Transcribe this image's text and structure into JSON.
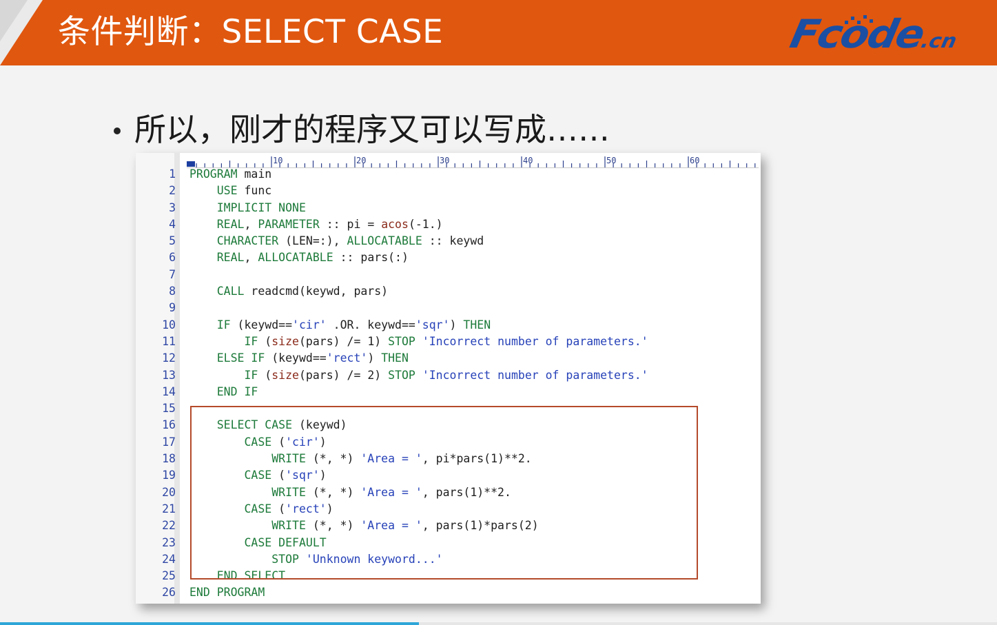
{
  "header": {
    "title": "条件判断：SELECT CASE",
    "logo_text": "Fcode",
    "logo_suffix": ".cn",
    "background_color": "#e0570f"
  },
  "bullet": {
    "text": "所以，刚才的程序又可以写成……"
  },
  "editor": {
    "ruler_labels": [
      "10",
      "20",
      "30",
      "40",
      "50",
      "60"
    ],
    "lines": [
      {
        "n": "1",
        "tokens": [
          [
            "kw",
            "PROGRAM"
          ],
          [
            "plain",
            " main"
          ]
        ]
      },
      {
        "n": "2",
        "tokens": [
          [
            "plain",
            "    "
          ],
          [
            "kw",
            "USE"
          ],
          [
            "plain",
            " func"
          ]
        ]
      },
      {
        "n": "3",
        "tokens": [
          [
            "plain",
            "    "
          ],
          [
            "kw",
            "IMPLICIT NONE"
          ]
        ]
      },
      {
        "n": "4",
        "tokens": [
          [
            "plain",
            "    "
          ],
          [
            "kw",
            "REAL"
          ],
          [
            "plain",
            ", "
          ],
          [
            "kw",
            "PARAMETER"
          ],
          [
            "plain",
            " :: pi = "
          ],
          [
            "fn",
            "acos"
          ],
          [
            "plain",
            "(-1.)"
          ]
        ]
      },
      {
        "n": "5",
        "tokens": [
          [
            "plain",
            "    "
          ],
          [
            "kw",
            "CHARACTER"
          ],
          [
            "plain",
            " (LEN=:), "
          ],
          [
            "kw",
            "ALLOCATABLE"
          ],
          [
            "plain",
            " :: keywd"
          ]
        ]
      },
      {
        "n": "6",
        "tokens": [
          [
            "plain",
            "    "
          ],
          [
            "kw",
            "REAL"
          ],
          [
            "plain",
            ", "
          ],
          [
            "kw",
            "ALLOCATABLE"
          ],
          [
            "plain",
            " :: pars(:)"
          ]
        ]
      },
      {
        "n": "7",
        "tokens": []
      },
      {
        "n": "8",
        "tokens": [
          [
            "plain",
            "    "
          ],
          [
            "kw",
            "CALL"
          ],
          [
            "plain",
            " readcmd(keywd, pars)"
          ]
        ]
      },
      {
        "n": "9",
        "tokens": []
      },
      {
        "n": "10",
        "tokens": [
          [
            "plain",
            "    "
          ],
          [
            "kw",
            "IF"
          ],
          [
            "plain",
            " (keywd=="
          ],
          [
            "str",
            "'cir'"
          ],
          [
            "plain",
            " .OR. keywd=="
          ],
          [
            "str",
            "'sqr'"
          ],
          [
            "plain",
            ") "
          ],
          [
            "kw",
            "THEN"
          ]
        ]
      },
      {
        "n": "11",
        "tokens": [
          [
            "plain",
            "        "
          ],
          [
            "kw",
            "IF"
          ],
          [
            "plain",
            " ("
          ],
          [
            "fn",
            "size"
          ],
          [
            "plain",
            "(pars) /= 1) "
          ],
          [
            "kw",
            "STOP"
          ],
          [
            "plain",
            " "
          ],
          [
            "str",
            "'Incorrect number of parameters.'"
          ]
        ]
      },
      {
        "n": "12",
        "tokens": [
          [
            "plain",
            "    "
          ],
          [
            "kw",
            "ELSE IF"
          ],
          [
            "plain",
            " (keywd=="
          ],
          [
            "str",
            "'rect'"
          ],
          [
            "plain",
            ") "
          ],
          [
            "kw",
            "THEN"
          ]
        ]
      },
      {
        "n": "13",
        "tokens": [
          [
            "plain",
            "        "
          ],
          [
            "kw",
            "IF"
          ],
          [
            "plain",
            " ("
          ],
          [
            "fn",
            "size"
          ],
          [
            "plain",
            "(pars) /= 2) "
          ],
          [
            "kw",
            "STOP"
          ],
          [
            "plain",
            " "
          ],
          [
            "str",
            "'Incorrect number of parameters.'"
          ]
        ]
      },
      {
        "n": "14",
        "tokens": [
          [
            "plain",
            "    "
          ],
          [
            "kw",
            "END IF"
          ]
        ]
      },
      {
        "n": "15",
        "tokens": []
      },
      {
        "n": "16",
        "tokens": [
          [
            "plain",
            "    "
          ],
          [
            "kw",
            "SELECT CASE"
          ],
          [
            "plain",
            " (keywd)"
          ]
        ]
      },
      {
        "n": "17",
        "tokens": [
          [
            "plain",
            "        "
          ],
          [
            "kw",
            "CASE"
          ],
          [
            "plain",
            " ("
          ],
          [
            "str",
            "'cir'"
          ],
          [
            "plain",
            ")"
          ]
        ]
      },
      {
        "n": "18",
        "tokens": [
          [
            "plain",
            "            "
          ],
          [
            "kw",
            "WRITE"
          ],
          [
            "plain",
            " (*, *) "
          ],
          [
            "str",
            "'Area = '"
          ],
          [
            "plain",
            ", pi*pars(1)**2."
          ]
        ]
      },
      {
        "n": "19",
        "tokens": [
          [
            "plain",
            "        "
          ],
          [
            "kw",
            "CASE"
          ],
          [
            "plain",
            " ("
          ],
          [
            "str",
            "'sqr'"
          ],
          [
            "plain",
            ")"
          ]
        ]
      },
      {
        "n": "20",
        "tokens": [
          [
            "plain",
            "            "
          ],
          [
            "kw",
            "WRITE"
          ],
          [
            "plain",
            " (*, *) "
          ],
          [
            "str",
            "'Area = '"
          ],
          [
            "plain",
            ", pars(1)**2."
          ]
        ]
      },
      {
        "n": "21",
        "tokens": [
          [
            "plain",
            "        "
          ],
          [
            "kw",
            "CASE"
          ],
          [
            "plain",
            " ("
          ],
          [
            "str",
            "'rect'"
          ],
          [
            "plain",
            ")"
          ]
        ]
      },
      {
        "n": "22",
        "tokens": [
          [
            "plain",
            "            "
          ],
          [
            "kw",
            "WRITE"
          ],
          [
            "plain",
            " (*, *) "
          ],
          [
            "str",
            "'Area = '"
          ],
          [
            "plain",
            ", pars(1)*pars(2)"
          ]
        ]
      },
      {
        "n": "23",
        "tokens": [
          [
            "plain",
            "        "
          ],
          [
            "kw",
            "CASE DEFAULT"
          ]
        ]
      },
      {
        "n": "24",
        "tokens": [
          [
            "plain",
            "            "
          ],
          [
            "kw",
            "STOP"
          ],
          [
            "plain",
            " "
          ],
          [
            "str",
            "'Unknown keyword...'"
          ]
        ]
      },
      {
        "n": "25",
        "tokens": [
          [
            "plain",
            "    "
          ],
          [
            "kw",
            "END SELECT"
          ]
        ]
      },
      {
        "n": "26",
        "tokens": [
          [
            "kw",
            "END PROGRAM"
          ]
        ]
      }
    ]
  },
  "colors": {
    "keyword": "#1d7a3a",
    "string": "#2742b8",
    "intrinsic": "#8a2a1a",
    "line_number": "#2e46a3",
    "highlight_border": "#b44a2a"
  },
  "playback_progress": 0.42
}
